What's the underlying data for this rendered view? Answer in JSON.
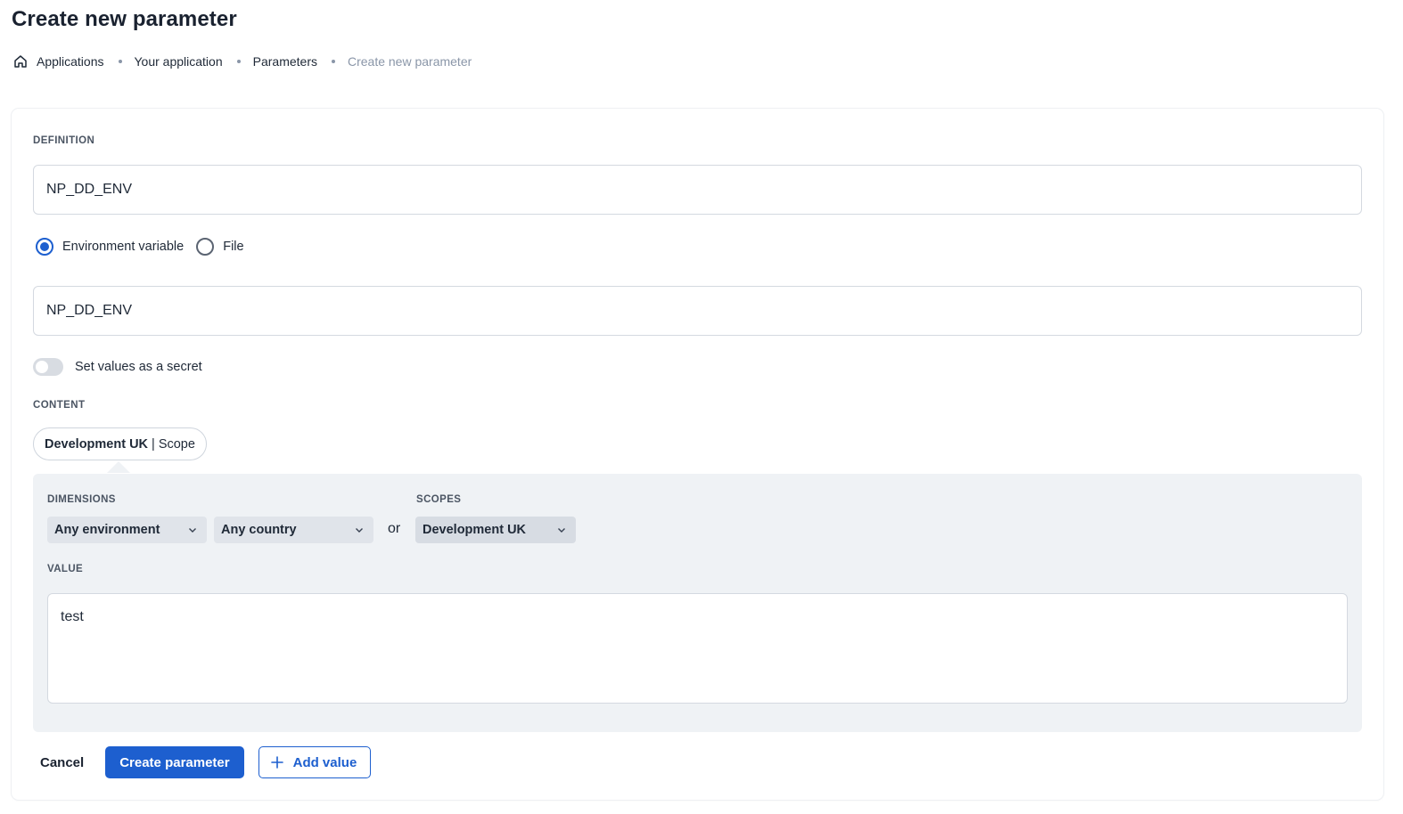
{
  "page": {
    "title": "Create new parameter"
  },
  "breadcrumb": {
    "home_icon": "home-icon",
    "items": [
      "Applications",
      "Your application",
      "Parameters"
    ],
    "current": "Create new parameter"
  },
  "definition": {
    "section_label": "DEFINITION",
    "name_value": "NP_DD_ENV",
    "type_options": [
      {
        "label": "Environment variable",
        "checked": true
      },
      {
        "label": "File",
        "checked": false
      }
    ],
    "env_var_value": "NP_DD_ENV",
    "secret_toggle": {
      "label": "Set values as a secret",
      "enabled": false
    }
  },
  "content": {
    "section_label": "CONTENT",
    "scope_pill": {
      "name": "Development UK",
      "separator": "|",
      "kind": "Scope"
    },
    "dimensions_label": "DIMENSIONS",
    "environment_select": "Any environment",
    "country_select": "Any country",
    "or_text": "or",
    "scopes_label": "SCOPES",
    "scope_select": "Development UK",
    "value_label": "VALUE",
    "value_text": "test"
  },
  "actions": {
    "cancel": "Cancel",
    "create": "Create parameter",
    "add_value": "Add value"
  },
  "colors": {
    "primary": "#1d5fcf",
    "panel_bg": "#eff2f5",
    "muted_text": "#8a96a8"
  }
}
